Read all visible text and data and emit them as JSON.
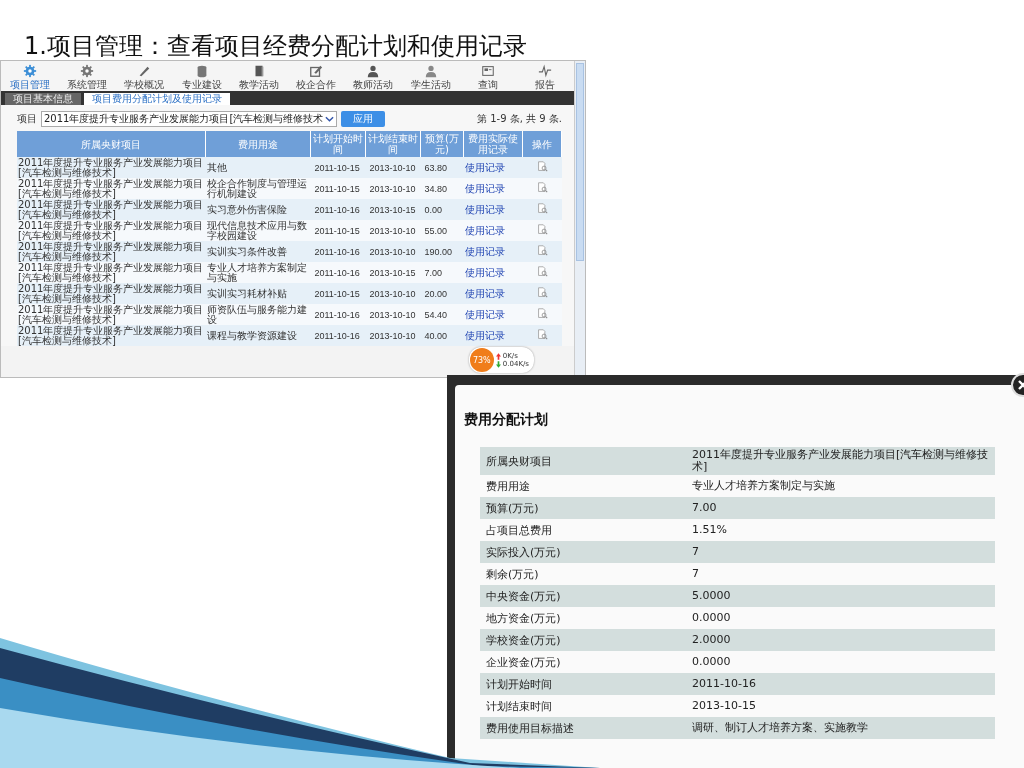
{
  "slide_title": "1.项目管理：查看项目经费分配计划和使用记录",
  "app": {
    "toolbar": [
      {
        "label": "项目管理",
        "selected": true
      },
      {
        "label": "系统管理",
        "selected": false
      },
      {
        "label": "学校概况",
        "selected": false
      },
      {
        "label": "专业建设",
        "selected": false
      },
      {
        "label": "教学活动",
        "selected": false
      },
      {
        "label": "校企合作",
        "selected": false
      },
      {
        "label": "教师活动",
        "selected": false
      },
      {
        "label": "学生活动",
        "selected": false
      },
      {
        "label": "查询",
        "selected": false
      },
      {
        "label": "报告",
        "selected": false
      }
    ],
    "tabs": [
      {
        "label": "项目基本信息",
        "selected": false
      },
      {
        "label": "项目费用分配计划及使用记录",
        "selected": true
      }
    ],
    "filter": {
      "label": "项目",
      "value": "2011年度提升专业服务产业发展能力项目[汽车检测与维修技术",
      "apply": "应用"
    },
    "record_count": "第 1-9 条, 共 9 条.",
    "table": {
      "columns": [
        "所属央财项目",
        "费用用途",
        "计划开始时间",
        "计划结束时间",
        "预算(万元)",
        "费用实际使用记录",
        "操作"
      ],
      "rows": [
        {
          "project": "2011年度提升专业服务产业发展能力项目[汽车检测与维修技术]",
          "purpose": "其他",
          "start": "2011-10-15",
          "end": "2013-10-10",
          "budget": "63.80",
          "link": "使用记录"
        },
        {
          "project": "2011年度提升专业服务产业发展能力项目[汽车检测与维修技术]",
          "purpose": "校企合作制度与管理运行机制建设",
          "start": "2011-10-15",
          "end": "2013-10-10",
          "budget": "34.80",
          "link": "使用记录"
        },
        {
          "project": "2011年度提升专业服务产业发展能力项目[汽车检测与维修技术]",
          "purpose": "实习意外伤害保险",
          "start": "2011-10-16",
          "end": "2013-10-15",
          "budget": "0.00",
          "link": "使用记录"
        },
        {
          "project": "2011年度提升专业服务产业发展能力项目[汽车检测与维修技术]",
          "purpose": "现代信息技术应用与数字校园建设",
          "start": "2011-10-15",
          "end": "2013-10-10",
          "budget": "55.00",
          "link": "使用记录"
        },
        {
          "project": "2011年度提升专业服务产业发展能力项目[汽车检测与维修技术]",
          "purpose": "实训实习条件改善",
          "start": "2011-10-16",
          "end": "2013-10-10",
          "budget": "190.00",
          "link": "使用记录"
        },
        {
          "project": "2011年度提升专业服务产业发展能力项目[汽车检测与维修技术]",
          "purpose": "专业人才培养方案制定与实施",
          "start": "2011-10-16",
          "end": "2013-10-15",
          "budget": "7.00",
          "link": "使用记录"
        },
        {
          "project": "2011年度提升专业服务产业发展能力项目[汽车检测与维修技术]",
          "purpose": "实训实习耗材补贴",
          "start": "2011-10-15",
          "end": "2013-10-10",
          "budget": "20.00",
          "link": "使用记录"
        },
        {
          "project": "2011年度提升专业服务产业发展能力项目[汽车检测与维修技术]",
          "purpose": "师资队伍与服务能力建设",
          "start": "2011-10-16",
          "end": "2013-10-10",
          "budget": "54.40",
          "link": "使用记录"
        },
        {
          "project": "2011年度提升专业服务产业发展能力项目[汽车检测与维修技术]",
          "purpose": "课程与教学资源建设",
          "start": "2011-10-16",
          "end": "2013-10-10",
          "budget": "40.00",
          "link": "使用记录"
        }
      ]
    },
    "network_widget": {
      "percent": "73%",
      "up": "0K/s",
      "down": "0.04K/s"
    }
  },
  "dialog": {
    "title": "费用分配计划",
    "rows": [
      {
        "label": "所属央财项目",
        "value": "2011年度提升专业服务产业发展能力项目[汽车检测与维修技术]"
      },
      {
        "label": "费用用途",
        "value": "专业人才培养方案制定与实施"
      },
      {
        "label": "预算(万元)",
        "value": "7.00"
      },
      {
        "label": "占项目总费用",
        "value": "1.51%"
      },
      {
        "label": "实际投入(万元)",
        "value": "7"
      },
      {
        "label": "剩余(万元)",
        "value": "7"
      },
      {
        "label": "中央资金(万元)",
        "value": "5.0000"
      },
      {
        "label": "地方资金(万元)",
        "value": "0.0000"
      },
      {
        "label": "学校资金(万元)",
        "value": "2.0000"
      },
      {
        "label": "企业资金(万元)",
        "value": "0.0000"
      },
      {
        "label": "计划开始时间",
        "value": "2011-10-16"
      },
      {
        "label": "计划结束时间",
        "value": "2013-10-15"
      },
      {
        "label": "费用使用目标描述",
        "value": "调研、制订人才培养方案、实施教学"
      }
    ]
  }
}
